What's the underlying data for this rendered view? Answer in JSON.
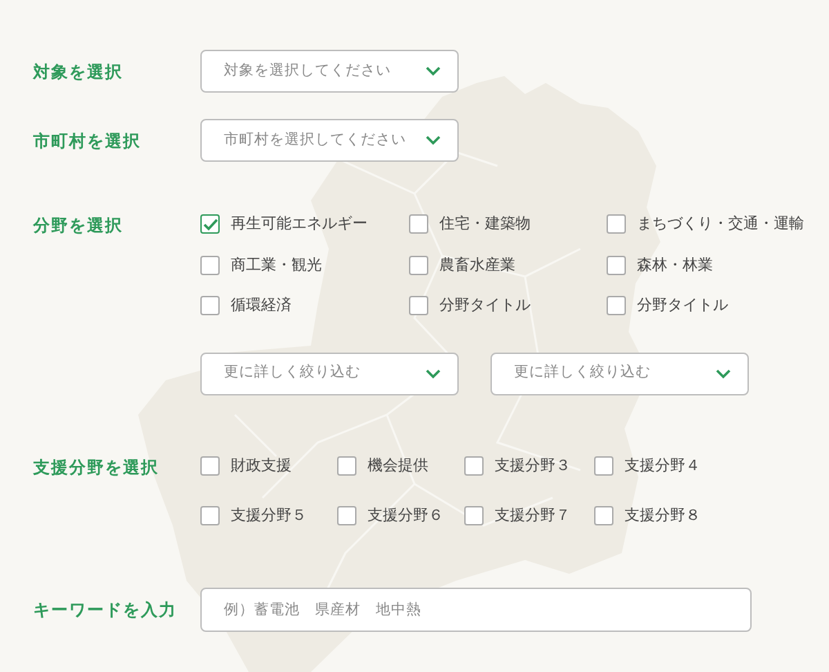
{
  "target": {
    "label": "対象を選択",
    "placeholder": "対象を選択してください"
  },
  "municipality": {
    "label": "市町村を選択",
    "placeholder": "市町村を選択してください"
  },
  "fields": {
    "label": "分野を選択",
    "options": [
      {
        "label": "再生可能エネルギー",
        "checked": true
      },
      {
        "label": "住宅・建築物",
        "checked": false
      },
      {
        "label": "まちづくり・交通・運輸",
        "checked": false
      },
      {
        "label": "商工業・観光",
        "checked": false
      },
      {
        "label": "農畜水産業",
        "checked": false
      },
      {
        "label": "森林・林業",
        "checked": false
      },
      {
        "label": "循環経済",
        "checked": false
      },
      {
        "label": "分野タイトル",
        "checked": false
      },
      {
        "label": "分野タイトル",
        "checked": false
      }
    ],
    "refine": [
      {
        "placeholder": "更に詳しく絞り込む"
      },
      {
        "placeholder": "更に詳しく絞り込む"
      }
    ]
  },
  "support": {
    "label": "支援分野を選択",
    "options": [
      {
        "label": "財政支援",
        "checked": false
      },
      {
        "label": "機会提供",
        "checked": false
      },
      {
        "label": "支援分野３",
        "checked": false
      },
      {
        "label": "支援分野４",
        "checked": false
      },
      {
        "label": "支援分野５",
        "checked": false
      },
      {
        "label": "支援分野６",
        "checked": false
      },
      {
        "label": "支援分野７",
        "checked": false
      },
      {
        "label": "支援分野８",
        "checked": false
      }
    ]
  },
  "keyword": {
    "label": "キーワードを入力",
    "placeholder": "例）蓄電池　県産材　地中熱"
  }
}
